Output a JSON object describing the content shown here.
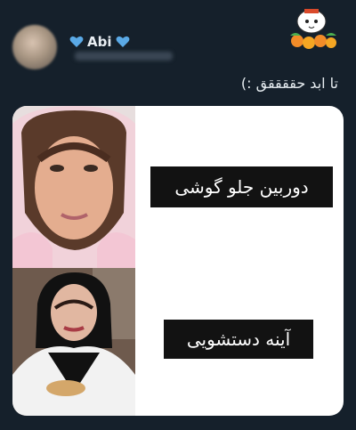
{
  "tweet": {
    "author_name": "Abi",
    "text": "تا ابد حققققق :)"
  },
  "meme": {
    "top_label": "دوربین جلو گوشی",
    "bottom_label": "آینه دستشویی"
  },
  "colors": {
    "background": "#15202b",
    "heart": "#5aa9e6",
    "label_bg": "#121212"
  }
}
